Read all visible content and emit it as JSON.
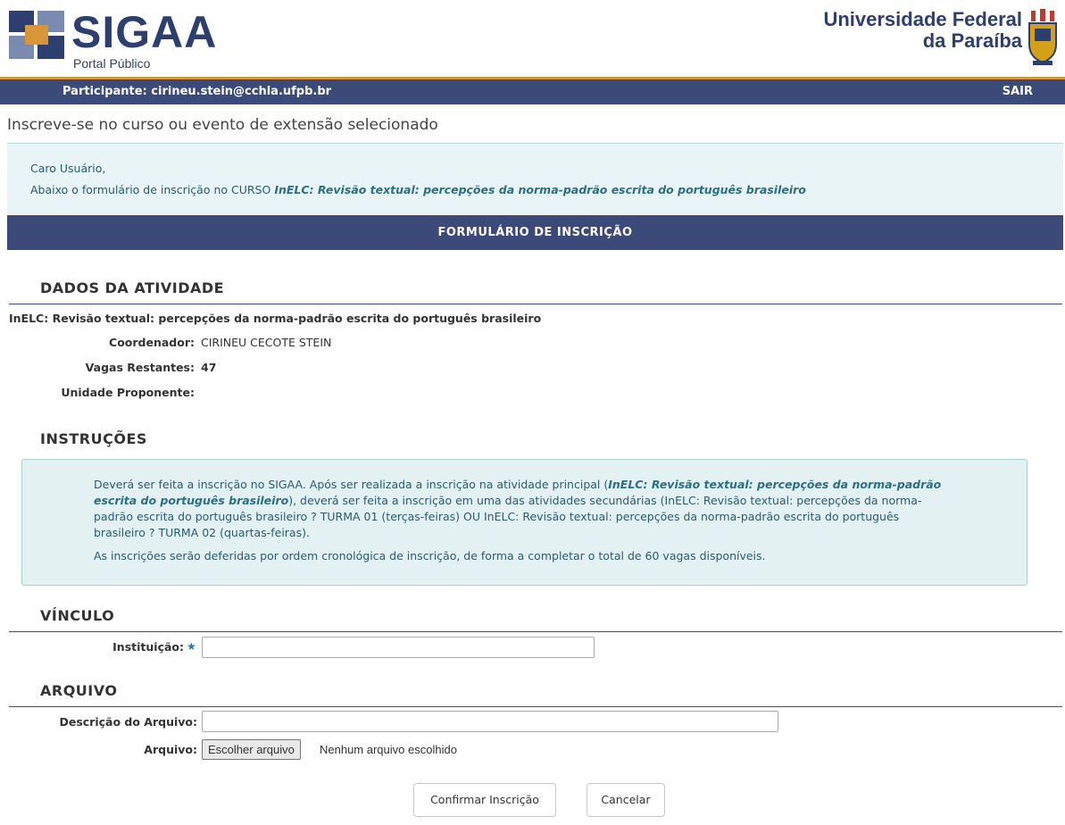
{
  "header": {
    "logo_text": "SIGAA",
    "logo_subtitle": "Portal Público",
    "university_line1": "Universidade Federal",
    "university_line2": "da Paraíba"
  },
  "participant_bar": {
    "participant": "Participante: cirineu.stein@cchla.ufpb.br",
    "logout": "SAIR"
  },
  "page_title": "Inscreve-se no curso ou evento de extensão selecionado",
  "info": {
    "greeting": "Caro Usuário,",
    "intro": "Abaixo o formulário de inscrição no CURSO",
    "course_name": "InELC: Revisão textual: percepções da norma-padrão escrita do português brasileiro"
  },
  "form_header": "FORMULÁRIO DE INSCRIÇÃO",
  "activity": {
    "section_title": "DADOS DA ATIVIDADE",
    "name": "InELC: Revisão textual: percepções da norma-padrão escrita do português brasileiro",
    "coordinator_label": "Coordenador:",
    "coordinator_value": "CIRINEU CECOTE STEIN",
    "vacancies_label": "Vagas Restantes:",
    "vacancies_value": "47",
    "unit_label": "Unidade Proponente:",
    "unit_value": ""
  },
  "instructions": {
    "section_title": "INSTRUÇÕES",
    "p1_start": "Deverá ser feita a inscrição no SIGAA. Após ser realizada a inscrição na atividade principal (",
    "p1_highlight": "InELC: Revisão textual: percepções da norma-padrão escrita do português brasileiro",
    "p1_end": "), deverá ser feita a inscrição em uma das atividades secundárias (InELC: Revisão textual: percepções da norma-padrão escrita do português brasileiro ? TURMA 01 (terças-feiras) OU InELC: Revisão textual: percepções da norma-padrão escrita do português brasileiro ? TURMA 02 (quartas-feiras).",
    "p2": "As inscrições serão deferidas por ordem cronológica de inscrição, de forma a completar o total de 60 vagas disponíveis."
  },
  "vinculo": {
    "section_title": "VÍNCULO",
    "institution_label": "Instituição:",
    "required_mark": "★",
    "institution_value": ""
  },
  "arquivo": {
    "section_title": "ARQUIVO",
    "description_label": "Descrição do Arquivo:",
    "description_value": "",
    "file_label": "Arquivo:",
    "file_button": "Escolher arquivo",
    "file_none": "Nenhum arquivo escolhido"
  },
  "actions": {
    "confirm": "Confirmar Inscrição",
    "cancel": "Cancelar"
  },
  "colors": {
    "navy": "#3c4a7a",
    "accent": "#d8963a",
    "info_bg": "#e8f4f5",
    "info_text": "#2a5b6d"
  }
}
